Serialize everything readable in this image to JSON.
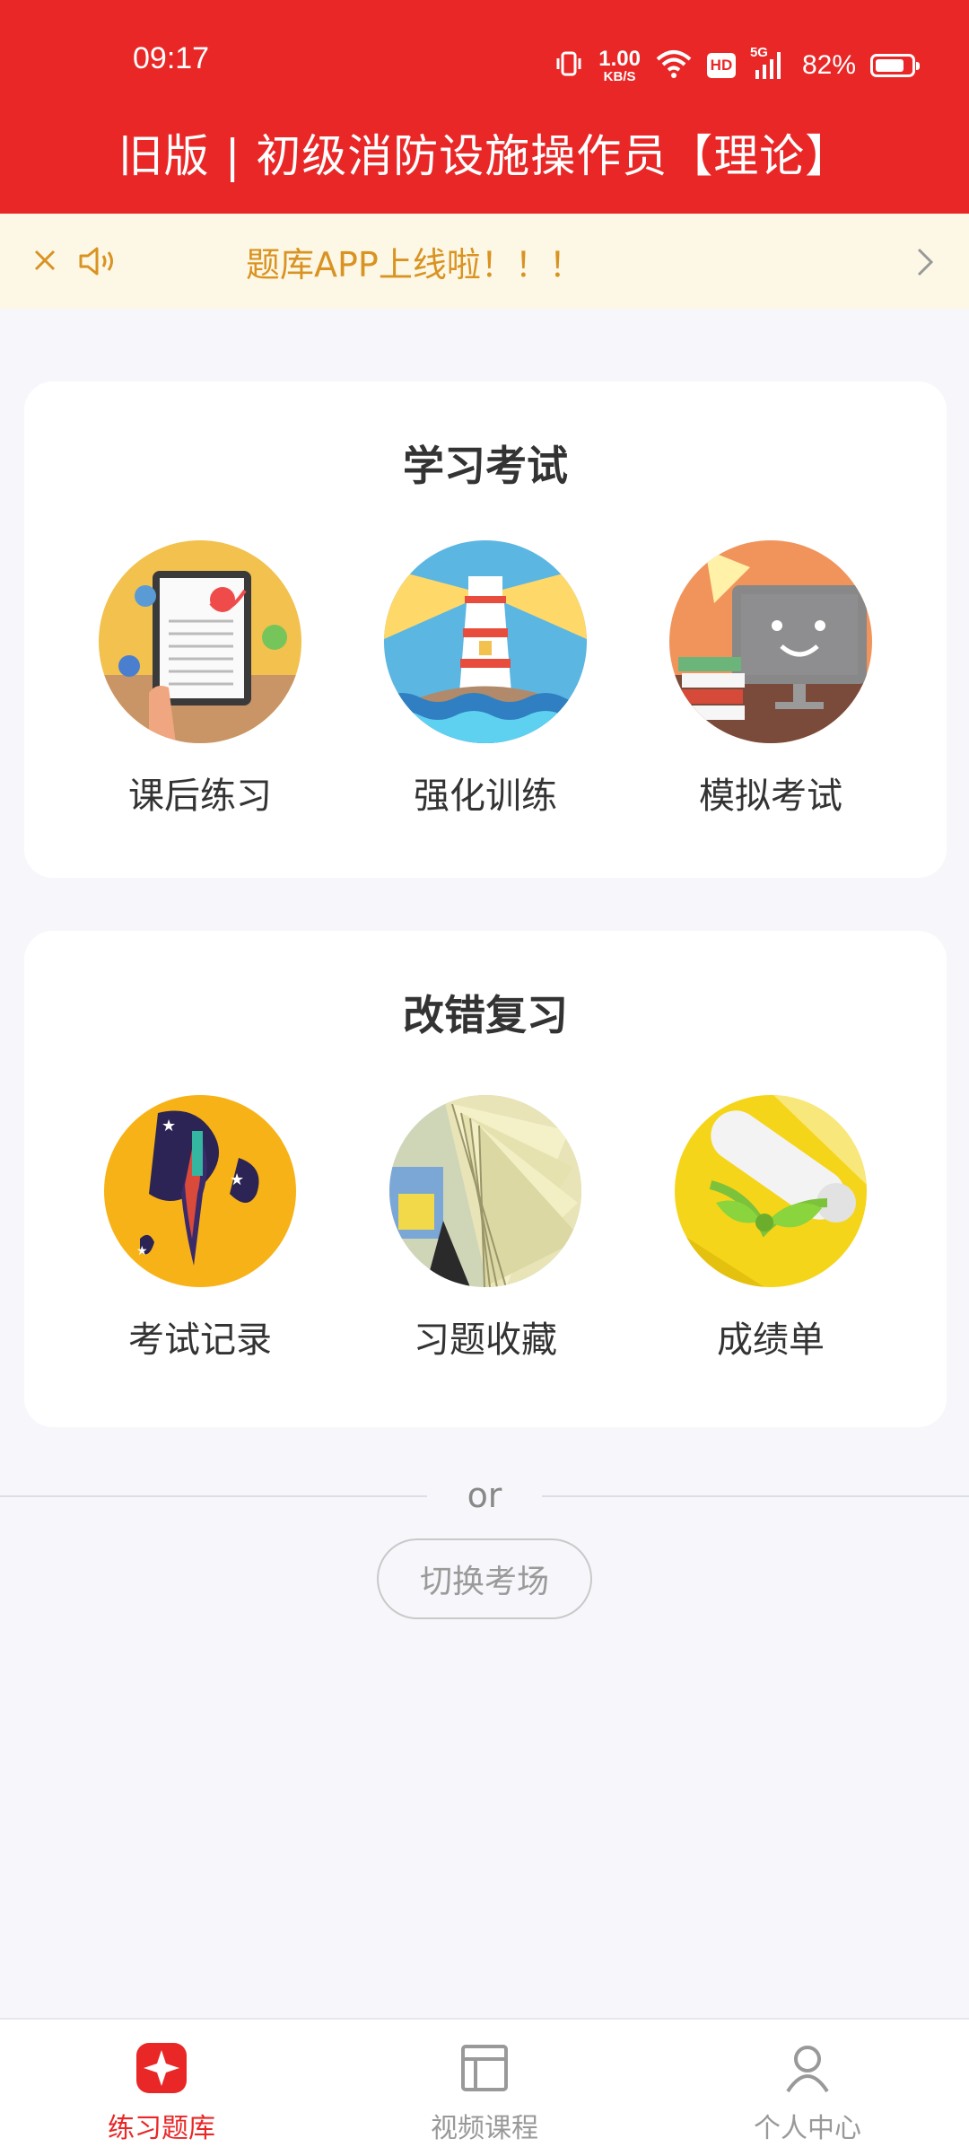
{
  "status_bar": {
    "time": "09:17",
    "net_speed_value": "1.00",
    "net_speed_unit": "KB/S",
    "hd_badge": "HD",
    "network_type": "5G",
    "battery_percent": "82%",
    "battery_level": 0.82
  },
  "header": {
    "title": "旧版 | 初级消防设施操作员【理论】",
    "bg_color": "#e92727"
  },
  "notice": {
    "close_icon": "close-icon",
    "speaker_icon": "speaker-icon",
    "text": "题库APP上线啦！！！",
    "arrow_icon": "chevron-right-icon",
    "text_color": "#d99322"
  },
  "study_section": {
    "title": "学习考试",
    "items": [
      {
        "label": "课后练习",
        "icon": "tablet-quiz-icon"
      },
      {
        "label": "强化训练",
        "icon": "lighthouse-icon"
      },
      {
        "label": "模拟考试",
        "icon": "computer-exam-icon"
      }
    ]
  },
  "review_section": {
    "title": "改错复习",
    "items": [
      {
        "label": "考试记录",
        "icon": "rocket-record-icon"
      },
      {
        "label": "习题收藏",
        "icon": "book-pages-icon"
      },
      {
        "label": "成绩单",
        "icon": "diploma-scroll-icon"
      }
    ]
  },
  "divider": {
    "text": "or"
  },
  "switch_button": {
    "label": "切换考场"
  },
  "bottom_nav": {
    "items": [
      {
        "label": "练习题库",
        "icon": "question-bank-icon",
        "active": true
      },
      {
        "label": "视频课程",
        "icon": "video-course-icon",
        "active": false
      },
      {
        "label": "个人中心",
        "icon": "user-icon",
        "active": false
      }
    ],
    "active_color": "#e92727"
  }
}
